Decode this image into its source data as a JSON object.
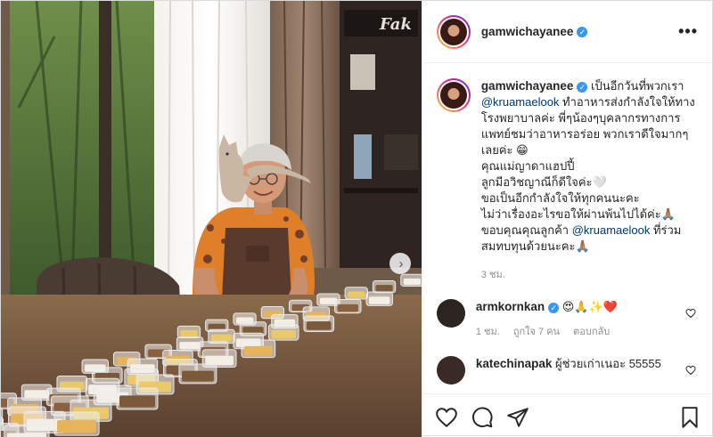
{
  "post": {
    "username": "gamwichayanee",
    "verified": true,
    "more_options_icon": "more-dots-icon",
    "next_icon": "chevron-right-icon"
  },
  "caption": {
    "username": "gamwichayanee",
    "line1_pre": "เป็นอีกวันที่พวกเรา",
    "mention1": "@kruamaelook",
    "line2_post": " ทำอาหารส่งกำลังใจให้ทางโรงพยาบาลค่ะ พี่ๆน้องๆบุคลากรทางการแพทย์ชมว่าอาหารอร่อย พวกเราดีใจมากๆเลยค่ะ 😁",
    "line_mom": "คุณแม่ญาดาแฮปปี้",
    "line_spirit": "ลูกมีอวิชญาณีก็ดีใจค่ะ🤍",
    "line_support": "ขอเป็นอีกกำลังใจให้ทุกคนนะคะ",
    "line_pass": "ไม่ว่าเรื่องอะไรขอให้ผ่านพ้นไปได้ค่ะ🙏🏽",
    "line_thanks_pre": "ขอบคุณคุณลูกค้า ",
    "mention2": "@kruamaelook",
    "line_thanks_post": " ที่ร่วมสมทบทุนด้วยนะคะ🙏🏽",
    "time": "3 ชม."
  },
  "comments": [
    {
      "username": "armkornkan",
      "verified": true,
      "text": "😍🙏✨❤️",
      "time": "1 ชม.",
      "likes": "ถูกใจ 7 คน",
      "reply": "ตอบกลับ",
      "avatar_color": "#2b2420"
    },
    {
      "username": "katechinapak",
      "verified": false,
      "text": "ผู้ช่วยเก่าเนอะ 55555",
      "avatar_color": "#3a2a26"
    }
  ],
  "actions": {
    "like_icon": "heart-icon",
    "comment_icon": "comment-icon",
    "share_icon": "share-icon",
    "save_icon": "bookmark-icon"
  },
  "photo": {
    "sign_text": "Fak"
  }
}
